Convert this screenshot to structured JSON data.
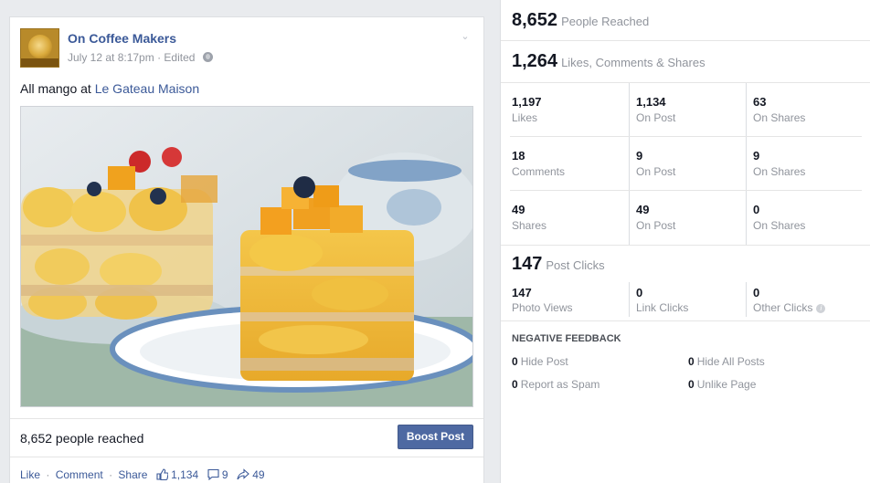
{
  "post": {
    "page_name": "On Coffee Makers",
    "timestamp": "July 12 at 8:17pm",
    "edited": "Edited",
    "text_prefix": "All mango at ",
    "text_link": "Le Gateau Maison",
    "reach_text": "8,652 people reached",
    "boost_label": "Boost Post",
    "actions": {
      "like": "Like",
      "comment": "Comment",
      "share": "Share",
      "likes_count": "1,134",
      "comments_count": "9",
      "shares_count": "49"
    },
    "icons": [
      "chevron-down-icon",
      "globe-icon",
      "thumbs-up-icon",
      "comment-icon",
      "share-icon"
    ]
  },
  "insights": {
    "people_reached": {
      "value": "8,652",
      "label": "People Reached"
    },
    "engagement": {
      "value": "1,264",
      "label": "Likes, Comments & Shares"
    },
    "grid": [
      [
        {
          "value": "1,197",
          "label": "Likes"
        },
        {
          "value": "1,134",
          "label": "On Post"
        },
        {
          "value": "63",
          "label": "On Shares"
        }
      ],
      [
        {
          "value": "18",
          "label": "Comments"
        },
        {
          "value": "9",
          "label": "On Post"
        },
        {
          "value": "9",
          "label": "On Shares"
        }
      ],
      [
        {
          "value": "49",
          "label": "Shares"
        },
        {
          "value": "49",
          "label": "On Post"
        },
        {
          "value": "0",
          "label": "On Shares"
        }
      ]
    ],
    "post_clicks": {
      "value": "147",
      "label": "Post Clicks"
    },
    "clicks": [
      {
        "value": "147",
        "label": "Photo Views"
      },
      {
        "value": "0",
        "label": "Link Clicks"
      },
      {
        "value": "0",
        "label": "Other Clicks"
      }
    ],
    "negative_feedback": {
      "title": "NEGATIVE FEEDBACK",
      "items": [
        {
          "value": "0",
          "label": "Hide Post"
        },
        {
          "value": "0",
          "label": "Hide All Posts"
        },
        {
          "value": "0",
          "label": "Report as Spam"
        },
        {
          "value": "0",
          "label": "Unlike Page"
        }
      ]
    }
  },
  "colors": {
    "facebook_blue": "#3b5998",
    "boost_button": "#4e69a2",
    "muted_text": "#90949c"
  }
}
